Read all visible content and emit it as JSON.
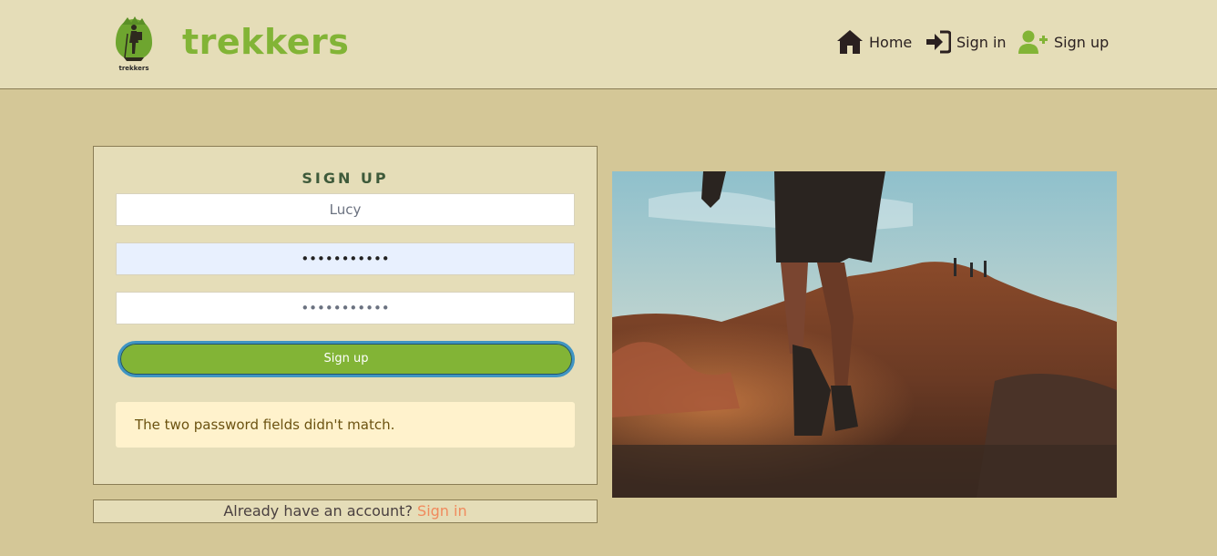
{
  "brand": {
    "name": "trekkers",
    "logo_caption": "trekkers"
  },
  "nav": {
    "home": {
      "label": "Home",
      "icon": "home-icon"
    },
    "signin": {
      "label": "Sign in",
      "icon": "sign-in-icon"
    },
    "signup": {
      "label": "Sign up",
      "icon": "user-plus-icon"
    }
  },
  "form": {
    "title": "SIGN UP",
    "username_value": "Lucy",
    "password1_value": "•••••••••••",
    "password2_value": "•••••••••••",
    "submit_label": "Sign up",
    "error_message": "The two password fields didn't match."
  },
  "footer": {
    "prompt": "Already have an account?",
    "link_label": "Sign in"
  },
  "colors": {
    "accent": "#82b436",
    "page_bg": "#d4c797",
    "panel_bg": "#e5ddb8",
    "link": "#f08a5d",
    "alert_bg": "#fff2cc"
  }
}
